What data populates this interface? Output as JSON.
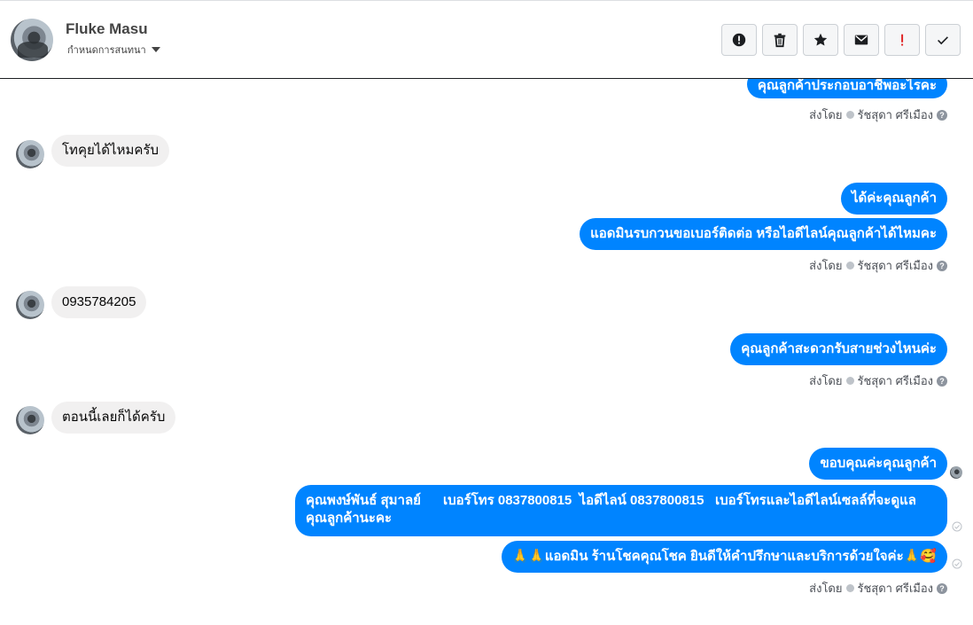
{
  "header": {
    "contact_name": "Fluke Masu",
    "conversation_settings": "กำหนดการสนทนา"
  },
  "actions": [
    {
      "name": "spam-button",
      "icon": "alert-circle-icon"
    },
    {
      "name": "delete-button",
      "icon": "trash-icon"
    },
    {
      "name": "star-button",
      "icon": "star-icon"
    },
    {
      "name": "mark-unread-button",
      "icon": "envelope-icon"
    },
    {
      "name": "important-button",
      "icon": "exclamation-icon"
    },
    {
      "name": "done-button",
      "icon": "check-icon"
    }
  ],
  "messages": {
    "m0": "คุณลูกค้าประกอบอาชีพอะไรคะ",
    "m1": "โทคุยได้ไหมครับ",
    "m2": "ได้ค่ะคุณลูกค้า",
    "m3": "แอดมินรบกวนขอเบอร์ติดต่อ หรือไอดีไลน์คุณลูกค้าได้ไหมคะ",
    "m4": "0935784205",
    "m5": "คุณลูกค้าสะดวกรับสายช่วงไหนค่ะ",
    "m6": "ตอนนี้เลยก็ได้ครับ",
    "m7": "ขอบคุณค่ะคุณลูกค้า",
    "m8_line1": "คุณพงษ์พันธ์ สุมาลย์      เบอร์โทร 0837800815  ไอดีไลน์ 0837800815   เบอร์โทรและไอดีไลน์เซลล์ที่จะดูแล",
    "m8_line2": "คุณลูกค้านะคะ",
    "m9": "🙏🙏แอดมิน ร้านโชคคุณโชค ยินดีให้คำปรึกษาและบริการด้วยใจค่ะ🙏🥰"
  },
  "sent_by": {
    "prefix": "ส่งโดย",
    "agent": "รัชสุดา ศรีเมือง",
    "help": "?"
  },
  "colors": {
    "outgoing_bubble": "#0084ff",
    "incoming_bubble": "#f1f0f0",
    "important_icon": "#e02424"
  }
}
